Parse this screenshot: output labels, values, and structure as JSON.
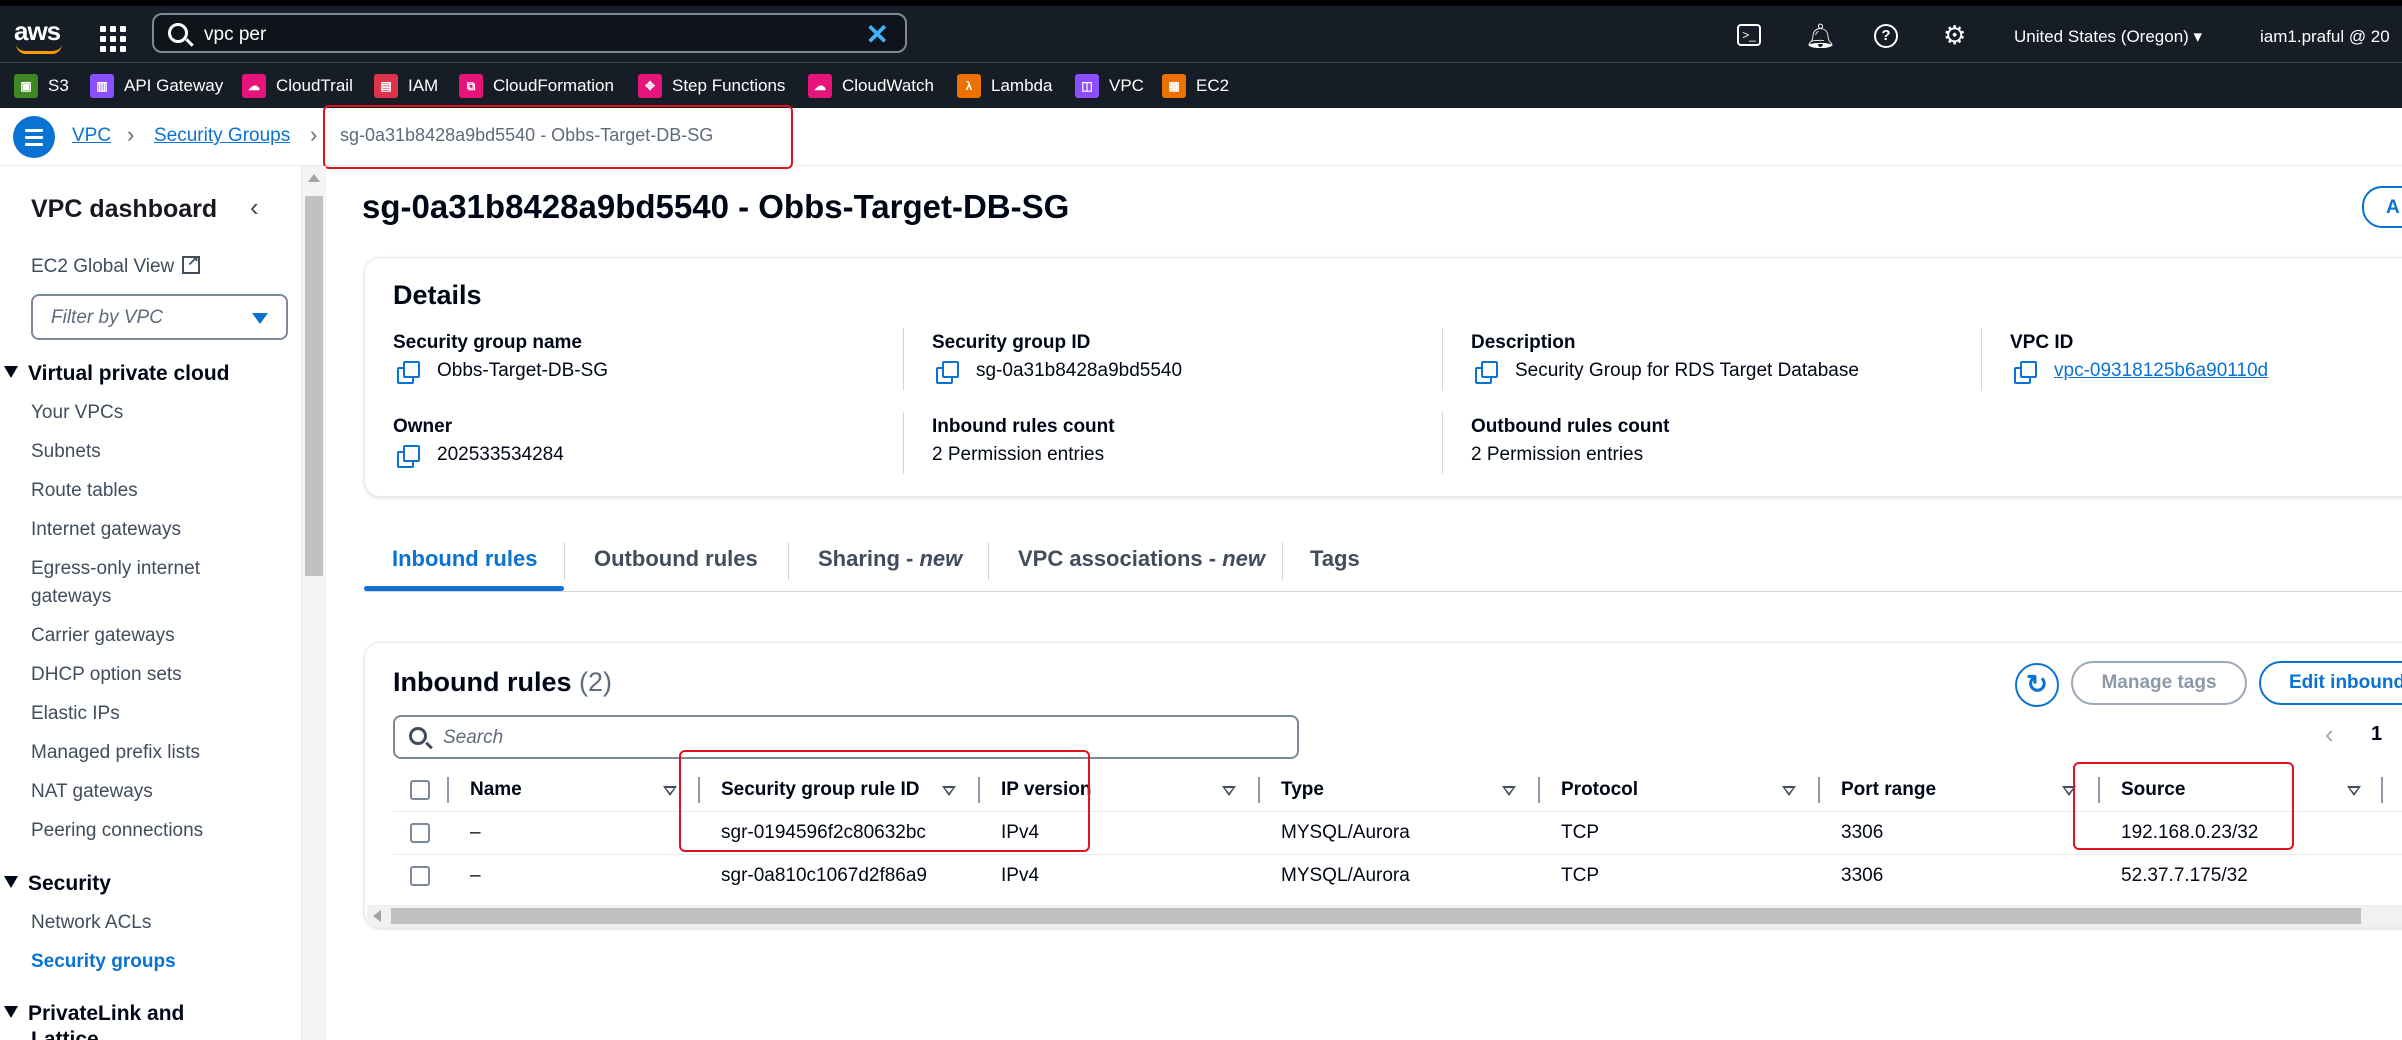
{
  "topnav": {
    "search_value": "vpc per",
    "region": "United States (Oregon) ▾",
    "user": "iam1.praful @ 20"
  },
  "favorites": [
    {
      "label": "S3",
      "color": "#3f8624"
    },
    {
      "label": "API Gateway",
      "color": "#8c4fff"
    },
    {
      "label": "CloudTrail",
      "color": "#e7157b"
    },
    {
      "label": "IAM",
      "color": "#dd344c"
    },
    {
      "label": "CloudFormation",
      "color": "#e7157b"
    },
    {
      "label": "Step Functions",
      "color": "#e7157b"
    },
    {
      "label": "CloudWatch",
      "color": "#e7157b"
    },
    {
      "label": "Lambda",
      "color": "#ed7100"
    },
    {
      "label": "VPC",
      "color": "#8c4fff"
    },
    {
      "label": "EC2",
      "color": "#ed7100"
    }
  ],
  "breadcrumb": {
    "items": [
      "VPC",
      "Security Groups"
    ],
    "current": "sg-0a31b8428a9bd5540 - Obbs-Target-DB-SG"
  },
  "sidebar": {
    "title": "VPC dashboard",
    "ec2_global_view": "EC2 Global View",
    "filter_placeholder": "Filter by VPC",
    "section_vpc": "Virtual private cloud",
    "vpc_items": [
      "Your VPCs",
      "Subnets",
      "Route tables",
      "Internet gateways",
      "Egress-only internet",
      "gateways",
      "Carrier gateways",
      "DHCP option sets",
      "Elastic IPs",
      "Managed prefix lists",
      "NAT gateways",
      "Peering connections"
    ],
    "section_security": "Security",
    "security_items": [
      "Network ACLs",
      "Security groups"
    ],
    "section_privatelink": "PrivateLink and",
    "section_privatelink_2": "Lattice"
  },
  "main": {
    "title": "sg-0a31b8428a9bd5540 - Obbs-Target-DB-SG",
    "actions_label": "A"
  },
  "details": {
    "heading": "Details",
    "sg_name_label": "Security group name",
    "sg_name": "Obbs-Target-DB-SG",
    "sg_id_label": "Security group ID",
    "sg_id": "sg-0a31b8428a9bd5540",
    "description_label": "Description",
    "description": "Security Group for RDS Target Database",
    "vpc_id_label": "VPC ID",
    "vpc_id": "vpc-09318125b6a90110d",
    "owner_label": "Owner",
    "owner": "202533534284",
    "inbound_count_label": "Inbound rules count",
    "inbound_count": "2 Permission entries",
    "outbound_count_label": "Outbound rules count",
    "outbound_count": "2 Permission entries"
  },
  "tabs": {
    "inbound": "Inbound rules",
    "outbound": "Outbound rules",
    "sharing": "Sharing - ",
    "sharing_new": "new",
    "vpc_assoc": "VPC associations - ",
    "vpc_assoc_new": "new",
    "tags": "Tags"
  },
  "rules": {
    "heading": "Inbound rules",
    "count": "(2)",
    "manage_tags": "Manage tags",
    "edit_inbound": "Edit inbound",
    "search_placeholder": "Search",
    "page": "1",
    "columns": [
      "Name",
      "Security group rule ID",
      "IP version",
      "Type",
      "Protocol",
      "Port range",
      "Source"
    ],
    "rows": [
      [
        "–",
        "sgr-0194596f2c80632bc",
        "IPv4",
        "MYSQL/Aurora",
        "TCP",
        "3306",
        "192.168.0.23/32"
      ],
      [
        "–",
        "sgr-0a810c1067d2f86a9",
        "IPv4",
        "MYSQL/Aurora",
        "TCP",
        "3306",
        "52.37.7.175/32"
      ]
    ]
  }
}
